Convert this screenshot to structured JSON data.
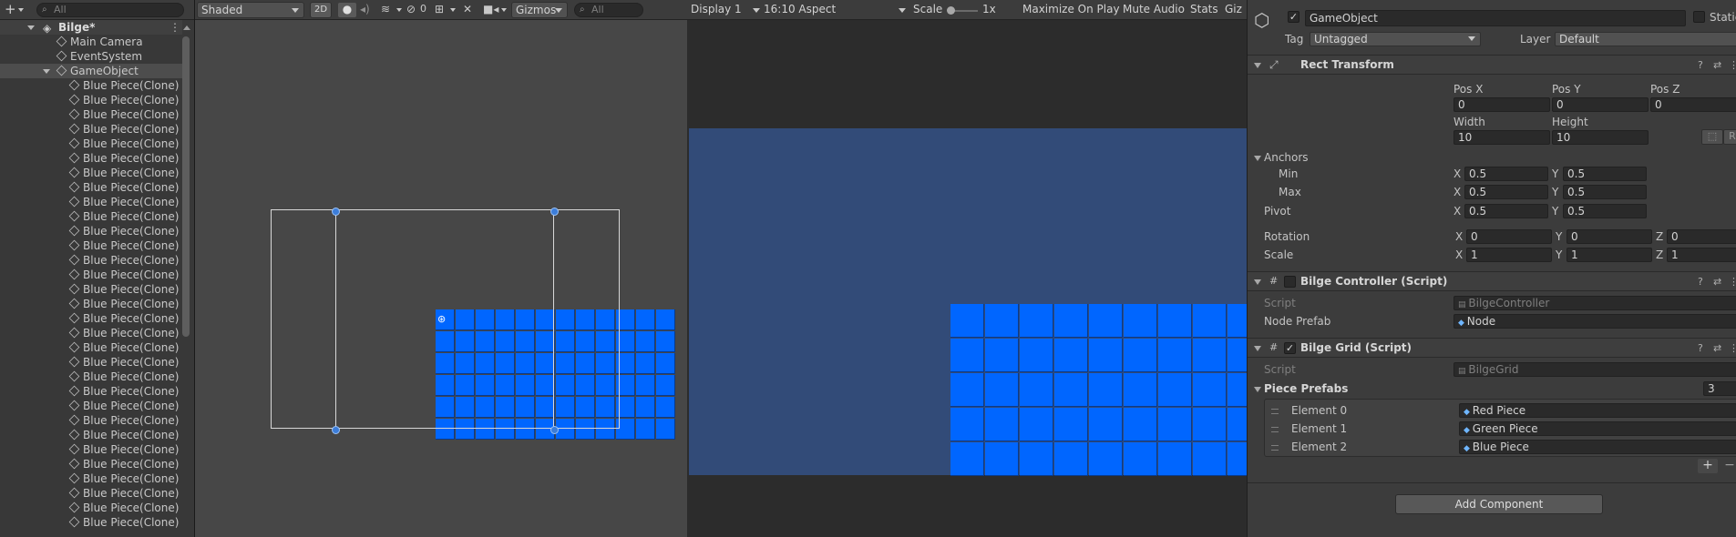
{
  "hierarchy": {
    "add_label": "+",
    "search_placeholder": "All",
    "scene_name": "Bilge*",
    "items": [
      "Main Camera",
      "EventSystem",
      "GameObject"
    ],
    "clone_label": "Blue Piece(Clone)"
  },
  "scene_toolbar": {
    "shading": "Shaded",
    "mode_2d": "2D",
    "hidden_count": "0",
    "gizmos": "Gizmos",
    "search_placeholder": "All"
  },
  "game_toolbar": {
    "display": "Display 1",
    "aspect": "16:10 Aspect",
    "scale_label": "Scale",
    "scale_value": "1x",
    "maximize": "Maximize On Play",
    "mute": "Mute Audio",
    "stats": "Stats",
    "gizmos_cut": "Giz"
  },
  "inspector": {
    "name": "GameObject",
    "static_label": "Static",
    "tag_label": "Tag",
    "tag_value": "Untagged",
    "layer_label": "Layer",
    "layer_value": "Default",
    "rect_transform": {
      "title": "Rect Transform",
      "pos_x_label": "Pos X",
      "pos_x": "0",
      "pos_y_label": "Pos Y",
      "pos_y": "0",
      "pos_z_label": "Pos Z",
      "pos_z": "0",
      "width_label": "Width",
      "width": "10",
      "height_label": "Height",
      "height": "10",
      "r_label": "R",
      "anchors_label": "Anchors",
      "min_label": "Min",
      "min_x": "0.5",
      "min_y": "0.5",
      "max_label": "Max",
      "max_x": "0.5",
      "max_y": "0.5",
      "pivot_label": "Pivot",
      "pivot_x": "0.5",
      "pivot_y": "0.5",
      "rotation_label": "Rotation",
      "rot_x": "0",
      "rot_y": "0",
      "rot_z": "0",
      "scale_label": "Scale",
      "scale_x": "1",
      "scale_y": "1",
      "scale_z": "1",
      "x": "X",
      "y": "Y",
      "z": "Z"
    },
    "bilge_controller": {
      "title": "Bilge Controller (Script)",
      "script_label": "Script",
      "script_value": "BilgeController",
      "node_prefab_label": "Node Prefab",
      "node_prefab_value": "Node"
    },
    "bilge_grid": {
      "title": "Bilge Grid (Script)",
      "script_label": "Script",
      "script_value": "BilgeGrid",
      "piece_prefabs_label": "Piece Prefabs",
      "piece_prefabs_count": "3",
      "elements": [
        {
          "label": "Element 0",
          "value": "Red Piece"
        },
        {
          "label": "Element 1",
          "value": "Green Piece"
        },
        {
          "label": "Element 2",
          "value": "Blue Piece"
        }
      ],
      "plus": "+",
      "minus": "−"
    },
    "add_component": "Add Component"
  },
  "colors": {
    "piece_blue": "#0066ff",
    "game_bg": "#324b78",
    "scene_bg": "#474747",
    "handle_blue": "#3c7dd9"
  }
}
